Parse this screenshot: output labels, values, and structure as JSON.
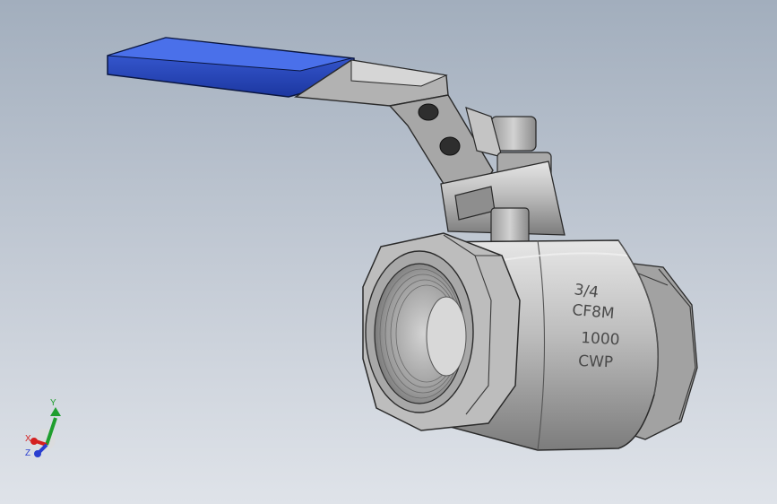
{
  "model": {
    "marking": {
      "size": "3/4",
      "material": "CF8M",
      "pressure": "1000",
      "rating": "CWP"
    }
  },
  "triad": {
    "y_label": "Y",
    "x_label": "X",
    "z_label": "Z"
  },
  "colors": {
    "background_top": "#a2aebd",
    "background_bottom": "#dfe3e9",
    "handle_grip": "#2546b8",
    "body_metal": "#b3b3b3",
    "axis_x": "#d42020",
    "axis_y": "#1f9e2e",
    "axis_z": "#2a3fd0"
  }
}
